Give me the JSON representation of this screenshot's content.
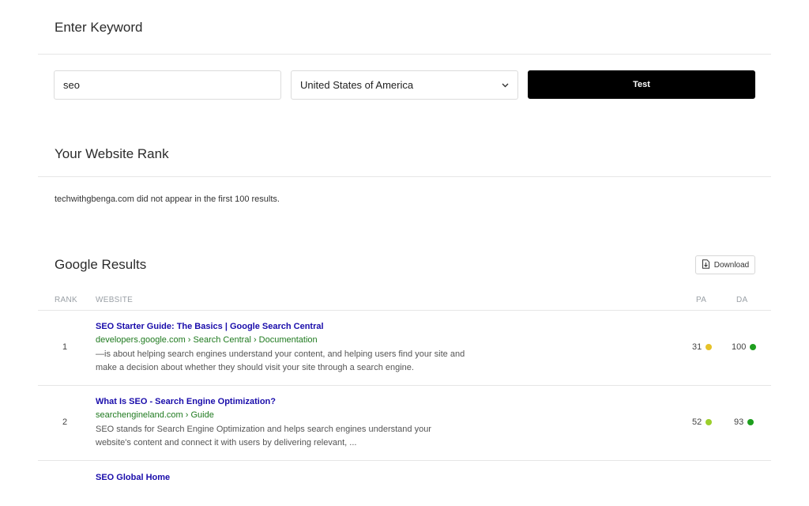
{
  "keyword_section": {
    "title": "Enter Keyword",
    "keyword_value": "seo",
    "country_value": "United States of America",
    "test_label": "Test"
  },
  "rank_section": {
    "title": "Your Website Rank",
    "message": "techwithgbenga.com did not appear in the first 100 results."
  },
  "results_section": {
    "title": "Google Results",
    "download_label": "Download",
    "headers": {
      "rank": "RANK",
      "website": "WEBSITE",
      "pa": "PA",
      "da": "DA"
    },
    "rows": [
      {
        "rank": "1",
        "title": "SEO Starter Guide: The Basics | Google Search Central",
        "url": "developers.google.com › Search Central › Documentation",
        "snippet": "—is about helping search engines understand your content, and helping users find your site and make a decision about whether they should visit your site through a search engine.",
        "pa": "31",
        "pa_color": "#e6c229",
        "da": "100",
        "da_color": "#1e9e1e"
      },
      {
        "rank": "2",
        "title": "What Is SEO - Search Engine Optimization?",
        "url": "searchengineland.com › Guide",
        "snippet": "SEO stands for Search Engine Optimization and helps search engines understand your website's content and connect it with users by delivering relevant, ...",
        "pa": "52",
        "pa_color": "#9ccf2c",
        "da": "93",
        "da_color": "#1e9e1e"
      },
      {
        "title": "SEO Global Home"
      }
    ]
  }
}
